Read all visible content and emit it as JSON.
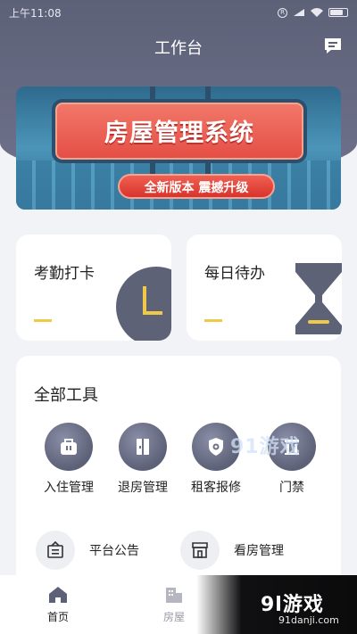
{
  "status": {
    "time": "上午11:08",
    "battery_icon": "battery-icon",
    "wifi_icon": "wifi-icon",
    "signal_icon": "signal-icon",
    "r_icon": "registered-icon"
  },
  "header": {
    "title": "工作台",
    "message_icon": "message-icon"
  },
  "banner": {
    "main_text": "房屋管理系统",
    "sub_text": "全新版本  震撼升级"
  },
  "cards": [
    {
      "label": "考勤打卡",
      "icon": "clock-icon"
    },
    {
      "label": "每日待办",
      "icon": "hourglass-icon"
    }
  ],
  "tools": {
    "title": "全部工具",
    "items": [
      {
        "label": "入住管理",
        "icon": "bag-icon"
      },
      {
        "label": "退房管理",
        "icon": "door-icon"
      },
      {
        "label": "租客报修",
        "icon": "gear-shield-icon"
      },
      {
        "label": "门禁",
        "icon": "gate-icon"
      }
    ],
    "rows": [
      {
        "label": "平台公告",
        "icon": "notice-icon"
      },
      {
        "label": "看房管理",
        "icon": "shop-icon"
      }
    ]
  },
  "watermark": "91游戏",
  "tabs": [
    {
      "label": "首页",
      "icon": "home-icon",
      "active": true
    },
    {
      "label": "房屋",
      "icon": "building-icon",
      "active": false
    }
  ],
  "promo": {
    "logo": "9l游戏",
    "url": "91danji.com"
  },
  "colors": {
    "header": "#5d6178",
    "accent": "#f1c94a",
    "background": "#f2f3f6"
  }
}
